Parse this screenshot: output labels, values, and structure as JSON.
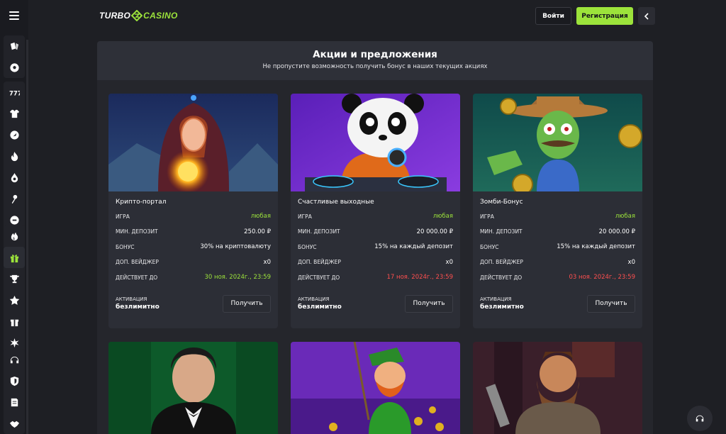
{
  "header": {
    "logo_left": "TURBO",
    "logo_right": "CASINO",
    "login_label": "Войти",
    "register_label": "Регистрация"
  },
  "hero": {
    "title": "Акции и предложения",
    "subtitle": "Не пропустите возможность получить бонус в наших текущих акциях"
  },
  "sidebar": {
    "icons_top": [
      "cards-icon",
      "soccer-ball-icon"
    ],
    "icons_mid": [
      "777-icon",
      "jersey-icon",
      "rocket-icon",
      "fire-icon",
      "flame-drop-icon",
      "joystick-icon",
      "gamepad-icon"
    ],
    "icons_promo": [
      "bonus-icon",
      "gift-icon",
      "trophy-icon",
      "star-icon",
      "present-icon",
      "wheel-icon"
    ],
    "icons_bottom": [
      "headset-icon",
      "shield-icon",
      "document-icon",
      "handshake-icon"
    ]
  },
  "promos": [
    {
      "title": "Крипто-портал",
      "rows": [
        {
          "key": "ИГРА",
          "value": "любая",
          "color": "green"
        },
        {
          "key": "МИН. ДЕПОЗИТ",
          "value": "250.00 ₽",
          "color": "white"
        },
        {
          "key": "БОНУС",
          "value": "30% на криптовалюту",
          "color": "white"
        },
        {
          "key": "ДОП. ВЕЙДЖЕР",
          "value": "x0",
          "color": "white"
        },
        {
          "key": "ДЕЙСТВУЕТ ДО",
          "value": "30 ноя. 2024г., 23:59",
          "color": "green"
        }
      ],
      "activation_label": "АКТИВАЦИЯ",
      "activation_value": "безлимитно",
      "button": "Получить"
    },
    {
      "title": "Счастливые выходные",
      "rows": [
        {
          "key": "ИГРА",
          "value": "любая",
          "color": "green"
        },
        {
          "key": "МИН. ДЕПОЗИТ",
          "value": "20 000.00 ₽",
          "color": "white"
        },
        {
          "key": "БОНУС",
          "value": "15% на каждый депозит",
          "color": "white"
        },
        {
          "key": "ДОП. ВЕЙДЖЕР",
          "value": "x0",
          "color": "white"
        },
        {
          "key": "ДЕЙСТВУЕТ ДО",
          "value": "17 ноя. 2024г., 23:59",
          "color": "red"
        }
      ],
      "activation_label": "АКТИВАЦИЯ",
      "activation_value": "безлимитно",
      "button": "Получить"
    },
    {
      "title": "Зомби-Бонус",
      "rows": [
        {
          "key": "ИГРА",
          "value": "любая",
          "color": "green"
        },
        {
          "key": "МИН. ДЕПОЗИТ",
          "value": "20 000.00 ₽",
          "color": "white"
        },
        {
          "key": "БОНУС",
          "value": "15% на каждый депозит",
          "color": "white"
        },
        {
          "key": "ДОП. ВЕЙДЖЕР",
          "value": "x0",
          "color": "white"
        },
        {
          "key": "ДЕЙСТВУЕТ ДО",
          "value": "03 ноя. 2024г., 23:59",
          "color": "red"
        }
      ],
      "activation_label": "АКТИВАЦИЯ",
      "activation_value": "безлимитно",
      "button": "Получить"
    }
  ],
  "colors": {
    "accent": "#9ce33b",
    "expired": "#ff4f4f",
    "background": "#1e1f24",
    "card": "#2c2e36"
  }
}
